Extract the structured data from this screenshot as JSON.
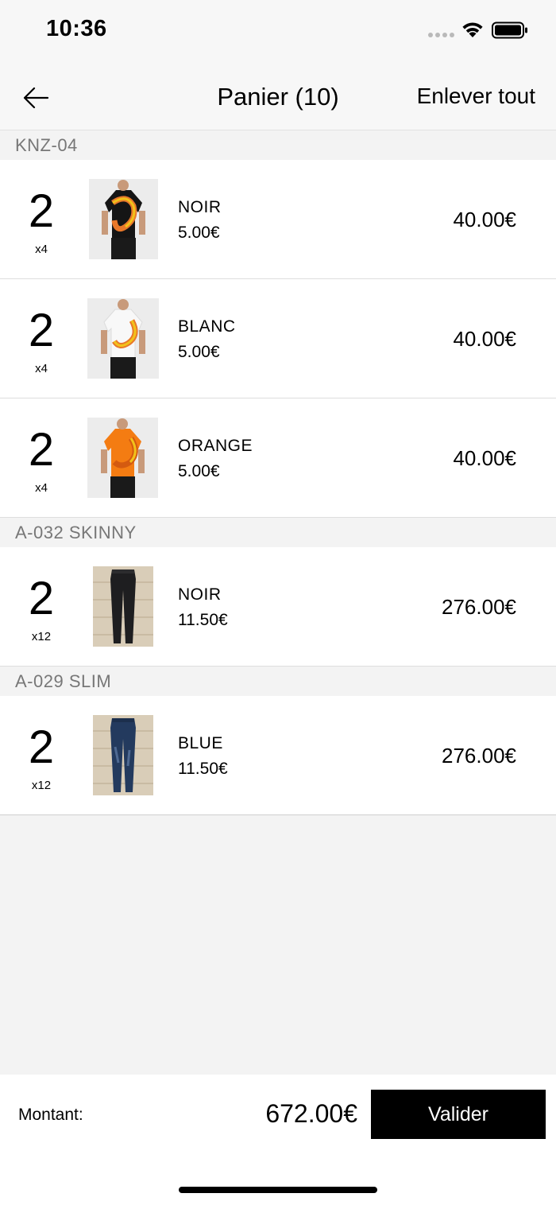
{
  "status_bar": {
    "time": "10:36"
  },
  "nav": {
    "title": "Panier (10)",
    "remove_all": "Enlever tout"
  },
  "sections": [
    {
      "header": "KNZ-04",
      "items": [
        {
          "qty": "2",
          "multiplier": "x4",
          "color": "NOIR",
          "unit_price": "5.00€",
          "total": "40.00€",
          "thumb": "tshirt-black"
        },
        {
          "qty": "2",
          "multiplier": "x4",
          "color": "BLANC",
          "unit_price": "5.00€",
          "total": "40.00€",
          "thumb": "tshirt-white"
        },
        {
          "qty": "2",
          "multiplier": "x4",
          "color": "ORANGE",
          "unit_price": "5.00€",
          "total": "40.00€",
          "thumb": "tshirt-orange"
        }
      ]
    },
    {
      "header": "A-032 SKINNY",
      "items": [
        {
          "qty": "2",
          "multiplier": "x12",
          "color": "NOIR",
          "unit_price": "11.50€",
          "total": "276.00€",
          "thumb": "jeans-black"
        }
      ]
    },
    {
      "header": "A-029 SLIM",
      "items": [
        {
          "qty": "2",
          "multiplier": "x12",
          "color": "BLUE",
          "unit_price": "11.50€",
          "total": "276.00€",
          "thumb": "jeans-blue"
        }
      ]
    }
  ],
  "footer": {
    "amount_label": "Montant:",
    "amount_value": "672.00€",
    "validate_label": "Valider"
  },
  "colors": {
    "tshirt_black": "#151515",
    "tshirt_white": "#f4f4f4",
    "tshirt_orange": "#f47c12",
    "print_orange": "#e8782a",
    "print_yellow": "#f2c21a",
    "jeans_black": "#1e1e20",
    "jeans_blue": "#233a5e",
    "brick_bg": "#d9cdb8",
    "photo_bg": "#ececec"
  }
}
